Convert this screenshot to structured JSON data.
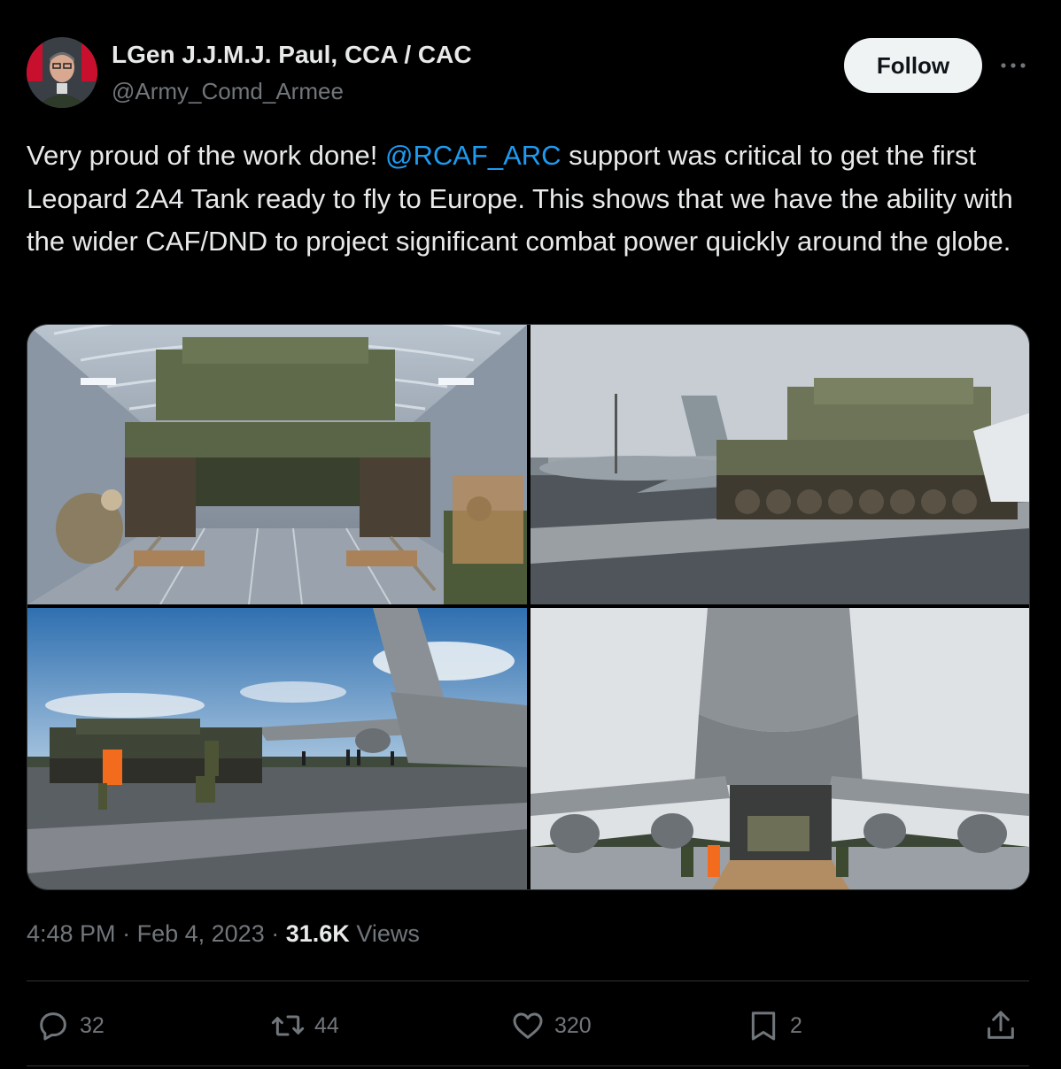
{
  "author": {
    "display_name": "LGen J.J.M.J. Paul, CCA / CAC",
    "handle": "@Army_Comd_Armee",
    "follow_label": "Follow"
  },
  "tweet": {
    "text_part1": "Very proud of the work done! ",
    "mention": "@RCAF_ARC",
    "text_part2": " support was critical to get the first Leopard 2A4 Tank ready to fly to Europe. This shows that we have the ability with the wider CAF/DND to project significant combat power quickly around the globe."
  },
  "meta": {
    "time": "4:48 PM",
    "separator": "·",
    "date": "Feb 4, 2023",
    "views_count": "31.6K",
    "views_label": "Views"
  },
  "actions": {
    "replies": "32",
    "retweets": "44",
    "likes": "320",
    "bookmarks": "2"
  },
  "icons": {
    "more": "more-options-icon",
    "reply": "reply-icon",
    "retweet": "retweet-icon",
    "like": "heart-icon",
    "bookmark": "bookmark-icon",
    "share": "share-icon"
  },
  "colors": {
    "background": "#000000",
    "text": "#e7e9ea",
    "muted": "#71767b",
    "link": "#1d9bf0",
    "divider": "#2f3336",
    "follow_bg": "#eff3f4"
  }
}
